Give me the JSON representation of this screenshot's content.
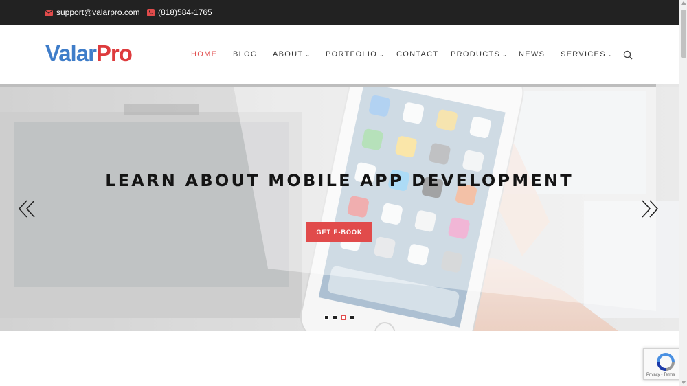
{
  "topbar": {
    "email": "support@valarpro.com",
    "email_icon": "envelope-icon",
    "phone": "(818)584-1765",
    "phone_icon": "phone-icon"
  },
  "header": {
    "logo_part1": "Valar",
    "logo_part2": "Pro",
    "nav": [
      {
        "label": "HOME",
        "active": true,
        "dropdown": false
      },
      {
        "label": "BLOG",
        "active": false,
        "dropdown": false
      },
      {
        "label": "ABOUT",
        "active": false,
        "dropdown": true
      },
      {
        "label": "PORTFOLIO",
        "active": false,
        "dropdown": true
      },
      {
        "label": "CONTACT",
        "active": false,
        "dropdown": false
      },
      {
        "label": "PRODUCTS",
        "active": false,
        "dropdown": true
      },
      {
        "label": "NEWS",
        "active": false,
        "dropdown": false
      },
      {
        "label": "SERVICES",
        "active": false,
        "dropdown": true
      }
    ],
    "search_icon": "search-icon"
  },
  "hero": {
    "title": "LEARN ABOUT MOBILE APP DEVELOPMENT",
    "cta_label": "GET E-BOOK",
    "slide_count": 4,
    "active_slide": 3
  },
  "recaptcha": {
    "links": "Privacy - Terms"
  },
  "colors": {
    "accent": "#e14b4b",
    "logo_blue": "#3f7dc9",
    "logo_red": "#de3b3d",
    "topbar": "#222222"
  }
}
